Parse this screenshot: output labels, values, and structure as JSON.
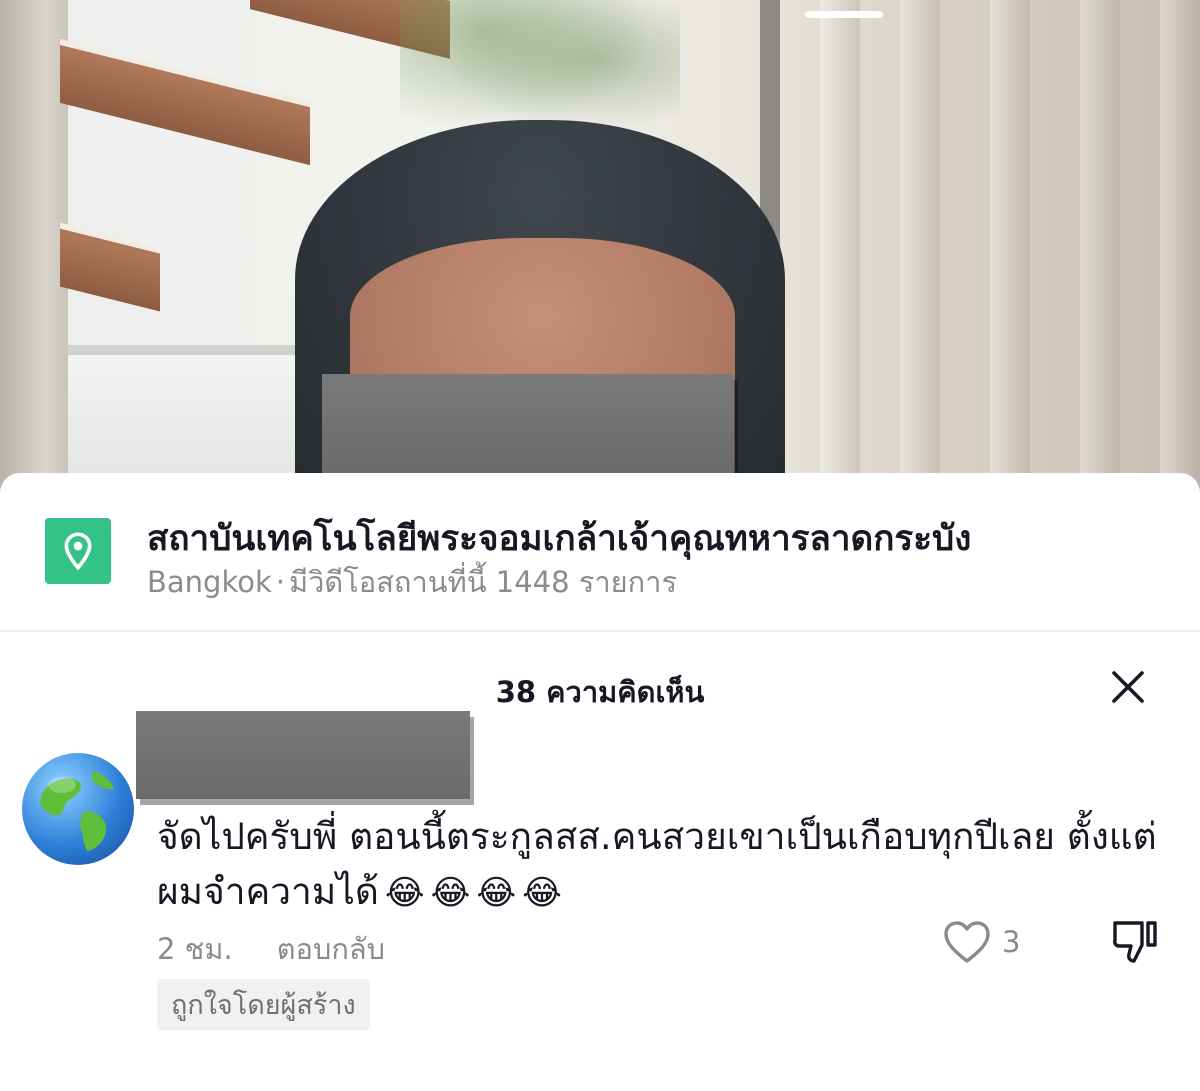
{
  "location": {
    "icon": "location-pin-icon",
    "title": "สถาบันเทคโนโลยีพระจอมเกล้าเจ้าคุณทหารลาดกระบัง",
    "city": "Bangkok",
    "separator": "·",
    "videos_text": "มีวิดีโอสถานที่นี้ 1448 รายการ"
  },
  "comments": {
    "title": "38 ความคิดเห็น",
    "close_icon": "close-icon"
  },
  "comment": {
    "text": "จัดไปครับพี่ ตอนนี้ตระกูลสส.คนสวยเขาเป็นเกือบทุกปีเลย ตั้งแต่ผมจำความได้",
    "emojis": [
      "😂",
      "😂",
      "😂",
      "😂"
    ],
    "time": "2 ชม.",
    "reply_label": "ตอบกลับ",
    "like_count": "3",
    "creator_badge": "ถูกใจโดยผู้สร้าง"
  },
  "colors": {
    "accent_green": "#35c289",
    "text_primary": "#161823",
    "text_secondary": "#8a8b91"
  }
}
